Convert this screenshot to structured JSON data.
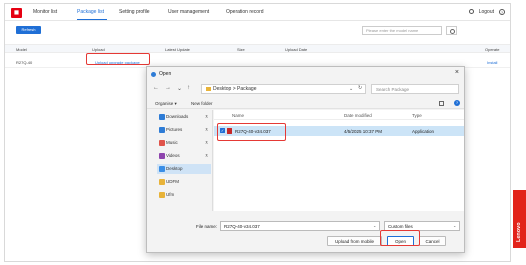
{
  "nav": {
    "logo_text": "◼",
    "items": [
      "Monitor list",
      "Package list",
      "Setting profile",
      "User management",
      "Operation record"
    ],
    "active_index": 1,
    "logout": "Logout",
    "help": "?"
  },
  "toolbar": {
    "refresh": "Refresh",
    "search_placeholder": "Please enter the model name"
  },
  "table": {
    "headers": [
      "Model",
      "Upload",
      "Latest Update",
      "Size",
      "Upload Date",
      "Operate"
    ],
    "rows": [
      {
        "model": "R27Q-40",
        "upload": "Upload upgrade package",
        "latest": "",
        "size": "",
        "date": "",
        "operate": "Install"
      }
    ]
  },
  "dialog": {
    "title": "Open",
    "close": "×",
    "back": "←",
    "forward": "→",
    "recent": "⌄",
    "up": "↑",
    "address": "Desktop > Package",
    "address_dropdown": "⌄",
    "refresh_icon": "↻",
    "search_placeholder": "Search Package",
    "organise": "Organise ▾",
    "new_folder": "New folder",
    "info": "?",
    "sidebar": [
      {
        "label": "Downloads",
        "color": "#2e7cd6",
        "pinned": true
      },
      {
        "label": "Pictures",
        "color": "#2e7cd6",
        "pinned": true
      },
      {
        "label": "Music",
        "color": "#e0534a",
        "pinned": true
      },
      {
        "label": "Videos",
        "color": "#8e44ad",
        "pinned": true
      },
      {
        "label": "Desktop",
        "color": "#3a8ee6",
        "pinned": false,
        "selected": true
      },
      {
        "label": "UDFM",
        "color": "#e8b339",
        "pinned": false
      },
      {
        "label": "Ufm",
        "color": "#e8b339",
        "pinned": false
      }
    ],
    "pin_glyph": "⊼",
    "columns": [
      "Name",
      "Date modified",
      "Type"
    ],
    "files": [
      {
        "name": "R27Q-40-v34.037",
        "date": "4/5/2025 10:37 PM",
        "type": "Application",
        "selected": true
      }
    ],
    "checkmark": "✓",
    "filename_label": "File name:",
    "filename_value": "R27Q-40-v34.037",
    "filename_dropdown": "⌄",
    "filter": "Custom files",
    "filter_dropdown": "⌄",
    "buttons": {
      "upload_mobile": "Upload from mobile",
      "open": "Open",
      "cancel": "Cancel"
    }
  },
  "brand": {
    "lenovo": "Lenovo",
    "accent": "#1f6fd6",
    "highlight": "#e53935"
  }
}
